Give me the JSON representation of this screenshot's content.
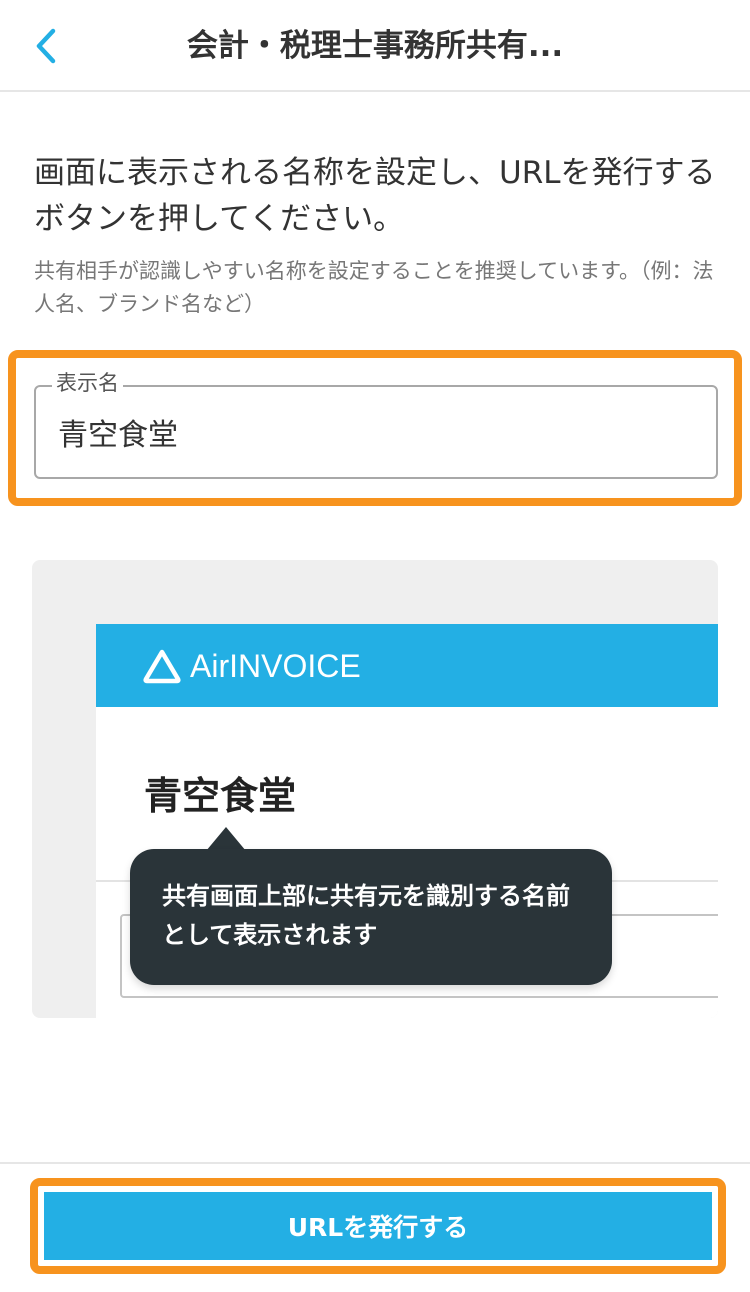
{
  "header": {
    "title": "会計・税理士事務所共有...",
    "back_icon": "chevron-left-icon"
  },
  "instruction": "画面に表示される名称を設定し、URLを発行するボタンを押してください。",
  "note": "共有相手が認識しやすい名称を設定することを推奨しています。（例：法人名、ブランド名など）",
  "field": {
    "label": "表示名",
    "value": "青空食堂"
  },
  "preview": {
    "brand": "AirINVOICE",
    "name": "青空食堂",
    "tooltip": "共有画面上部に共有元を識別する名前として表示されます"
  },
  "footer": {
    "cta_label": "URLを発行する"
  },
  "colors": {
    "accent": "#23afe4",
    "highlight": "#f7931e",
    "tooltip_bg": "#2a3439"
  }
}
